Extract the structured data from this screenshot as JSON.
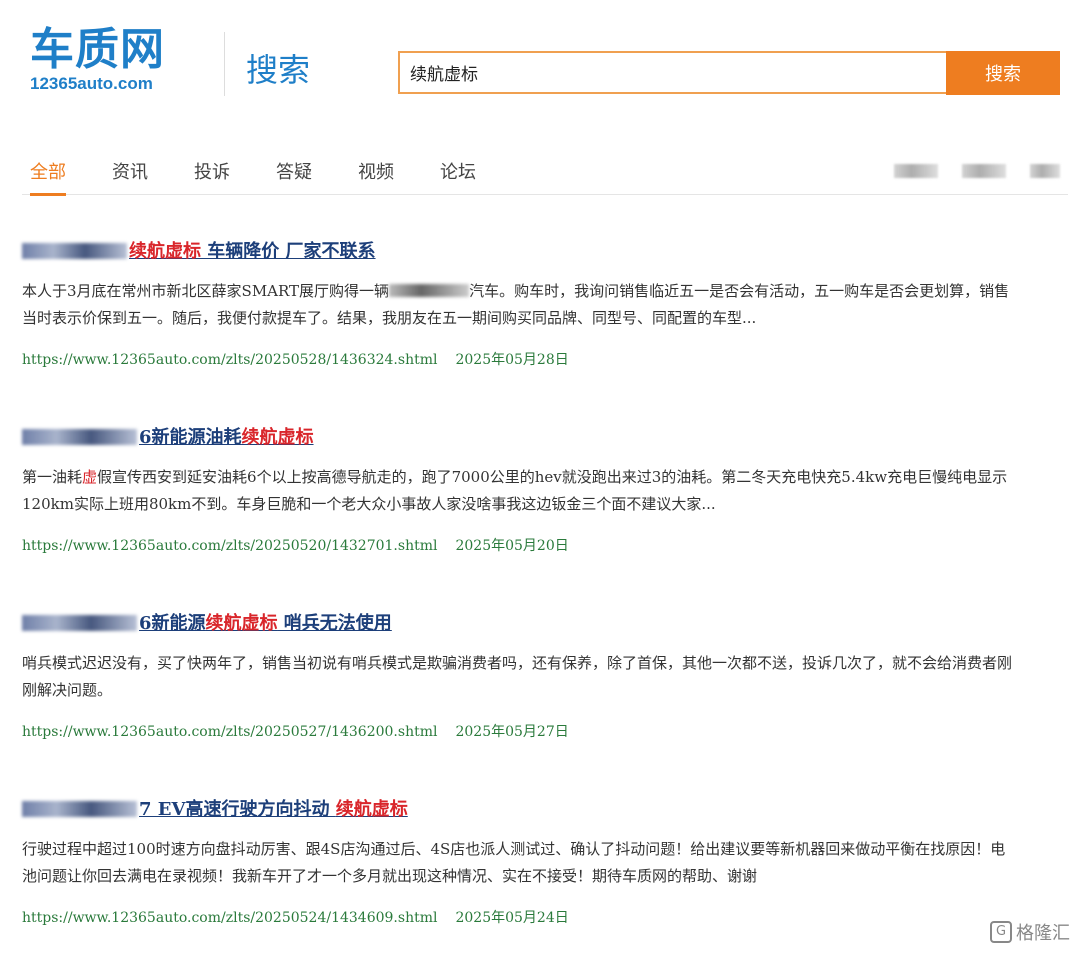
{
  "header": {
    "logo_main": "车质网",
    "logo_sub": "12365auto.com",
    "search_label": "搜索"
  },
  "search": {
    "value": "续航虚标",
    "button_label": "搜索"
  },
  "tabs": [
    {
      "label": "全部"
    },
    {
      "label": "资讯"
    },
    {
      "label": "投诉"
    },
    {
      "label": "答疑"
    },
    {
      "label": "视频"
    },
    {
      "label": "论坛"
    }
  ],
  "results": [
    {
      "title_highlight": "续航虚标",
      "title_suffix": " 车辆降价 厂家不联系",
      "desc_part1": "本人于3月底在常州市新北区薛家SMART展厅购得一辆",
      "desc_part2": "汽车。购车时，我询问销售临近五一是否会有活动，五一购车是否会更划算，销售当时表示价保到五一。随后，我便付款提车了。结果，我朋友在五一期间购买同品牌、同型号、同配置的车型...",
      "url": "https://www.12365auto.com/zlts/20250528/1436324.shtml",
      "date": "2025年05月28日"
    },
    {
      "title_mid": "6新能源油耗",
      "title_highlight": "续航虚标",
      "desc_part1": "第一油耗",
      "desc_hl": "虚",
      "desc_part2": "假宣传西安到延安油耗6个以上按高德导航走的，跑了7000公里的hev就没跑出来过3的油耗。第二冬天充电快充5.4kw充电巨慢纯电显示120km实际上班用80km不到。车身巨脆和一个老大众小事故人家没啥事我这边钣金三个面不建议大家...",
      "url": "https://www.12365auto.com/zlts/20250520/1432701.shtml",
      "date": "2025年05月20日"
    },
    {
      "title_mid": "6新能源",
      "title_highlight": "续航虚标",
      "title_suffix": " 哨兵无法使用",
      "desc": "哨兵模式迟迟没有，买了快两年了，销售当初说有哨兵模式是欺骗消费者吗，还有保养，除了首保，其他一次都不送，投诉几次了，就不会给消费者刚刚解决问题。",
      "url": "https://www.12365auto.com/zlts/20250527/1436200.shtml",
      "date": "2025年05月27日"
    },
    {
      "title_mid": "7 EV高速行驶方向抖动 ",
      "title_highlight": "续航虚标",
      "desc": "行驶过程中超过100时速方向盘抖动厉害、跟4S店沟通过后、4S店也派人测试过、确认了抖动问题！给出建议要等新机器回来做动平衡在找原因！电池问题让你回去满电在录视频！我新车开了才一个多月就出现这种情况、实在不接受！期待车质网的帮助、谢谢",
      "url": "https://www.12365auto.com/zlts/20250524/1434609.shtml",
      "date": "2025年05月24日"
    }
  ],
  "watermark": {
    "text": "格隆汇"
  }
}
